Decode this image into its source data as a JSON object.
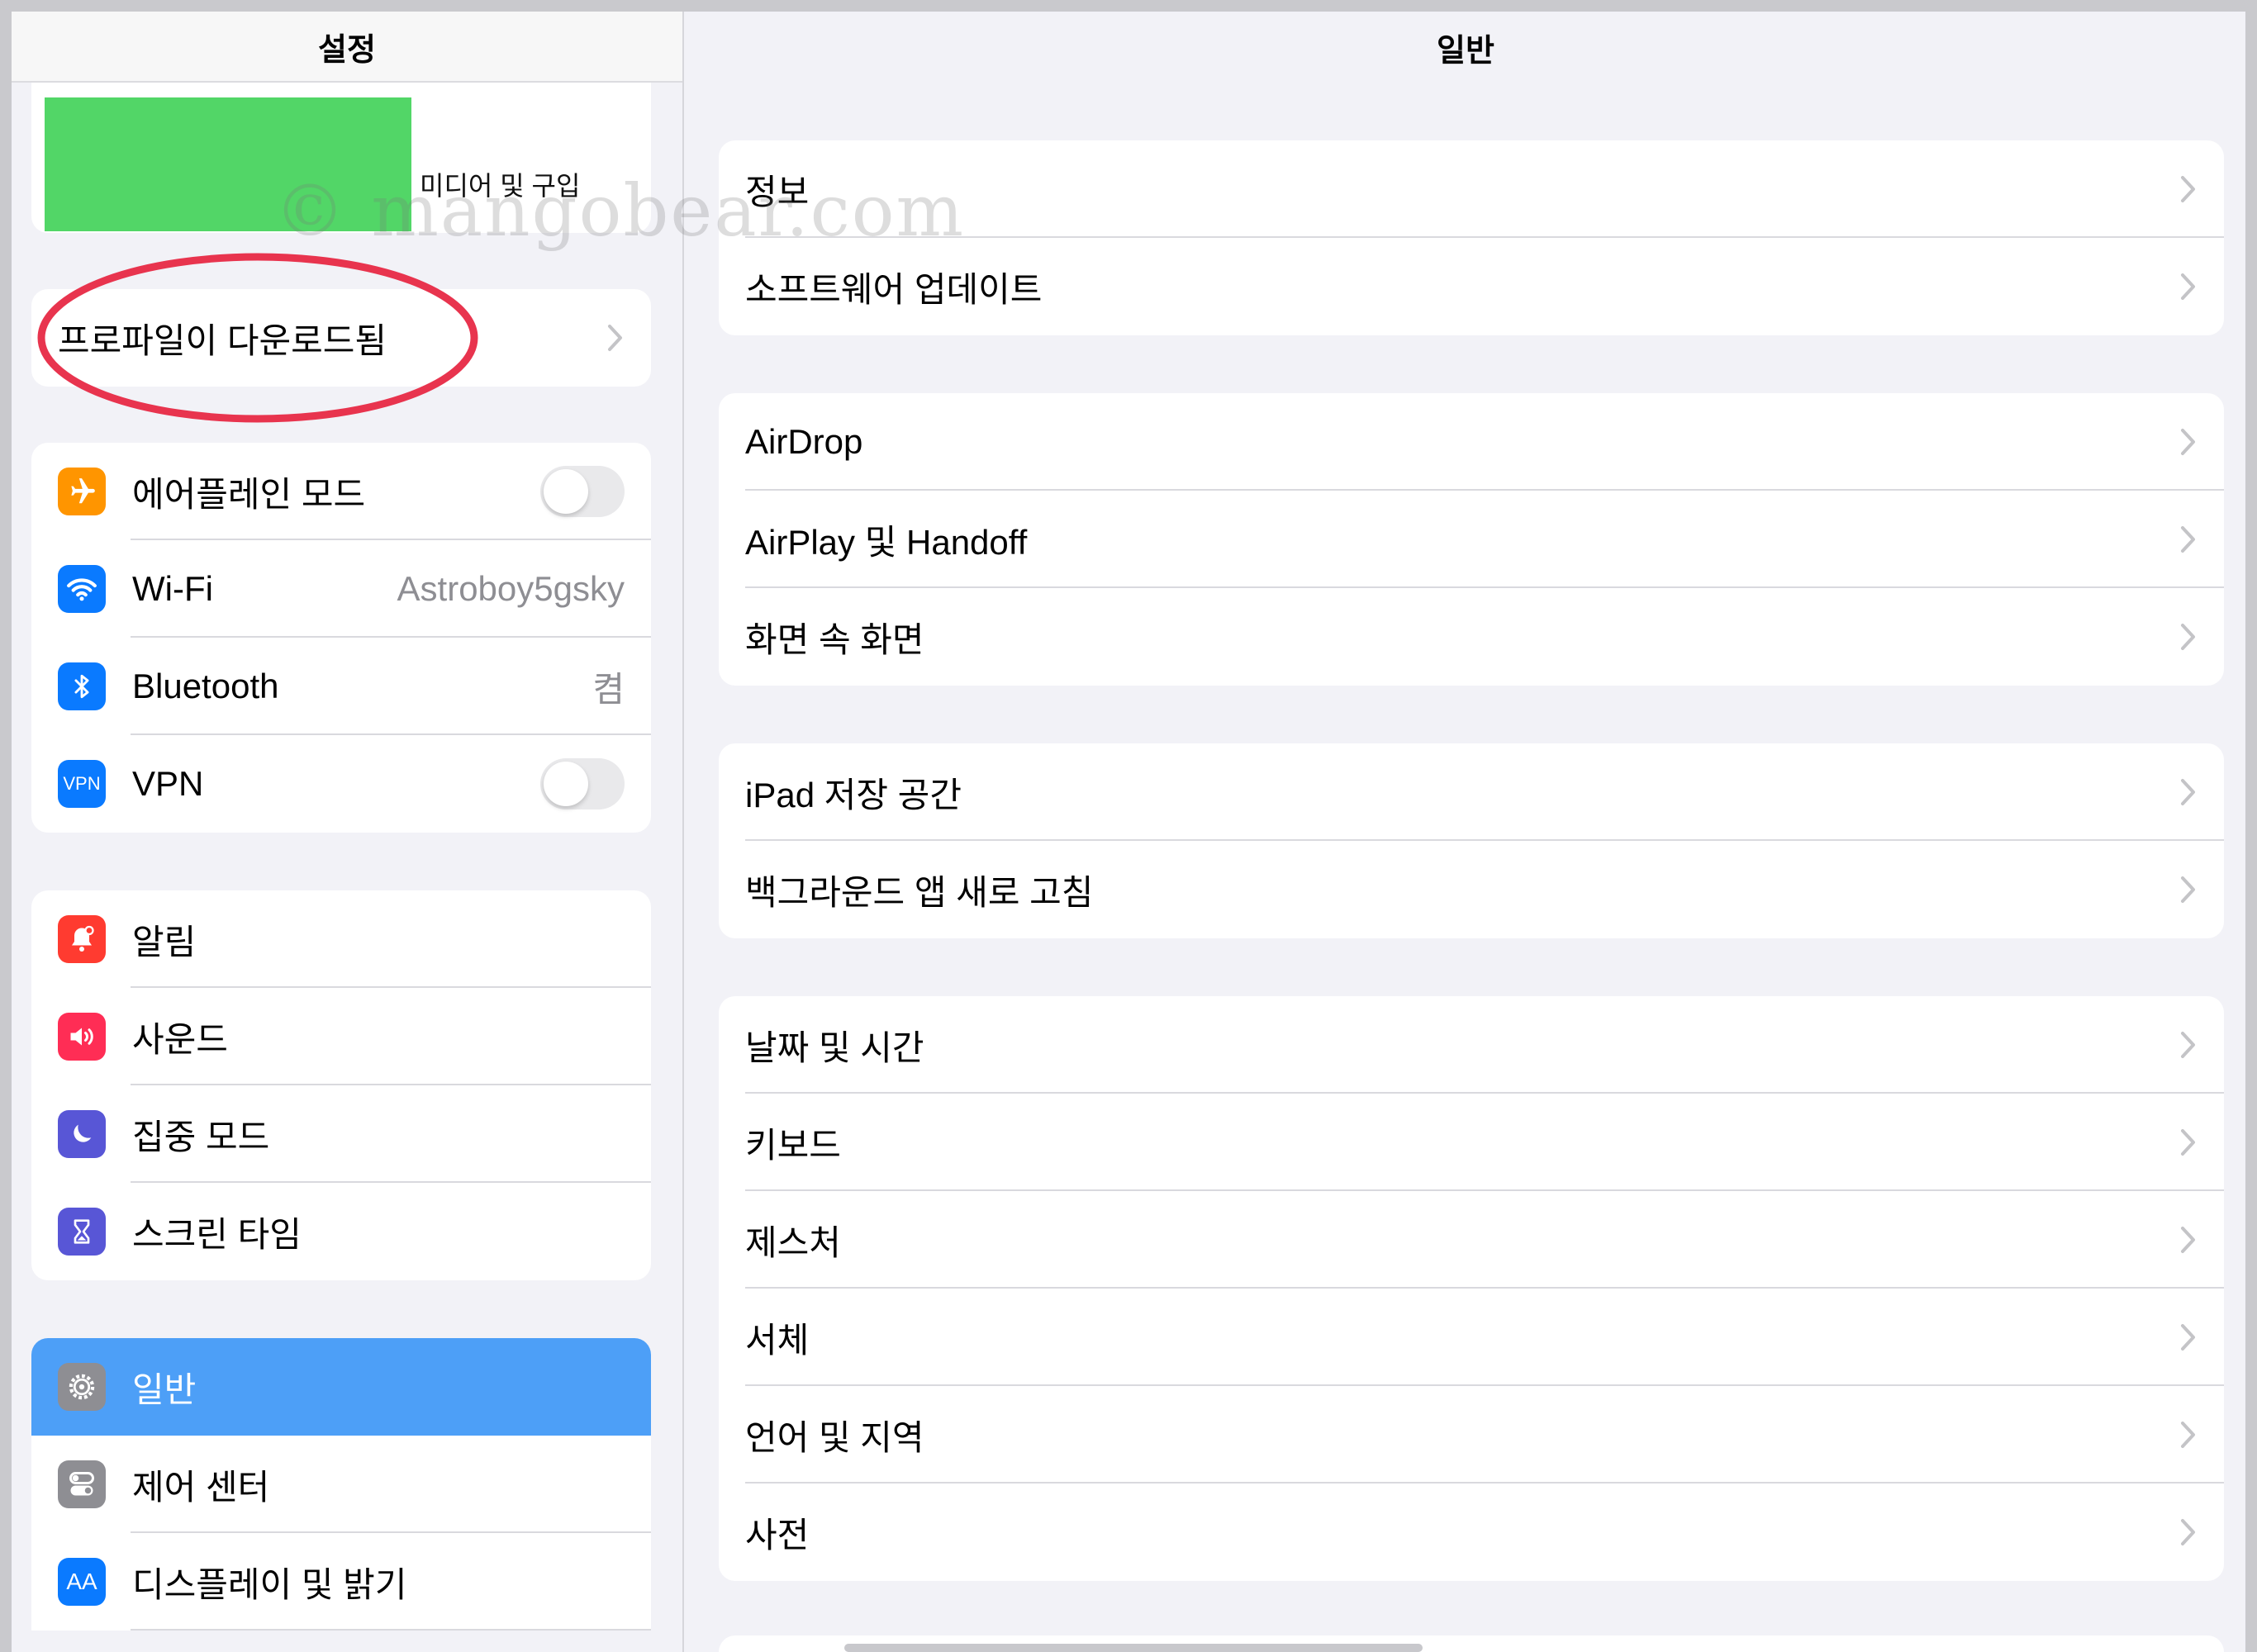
{
  "sidebar": {
    "title": "설정",
    "profile_subtitle": "미디어 및 구입",
    "profile_downloaded": "프로파일이 다운로드됨",
    "connectivity": [
      {
        "label": "에어플레인 모드",
        "icon": "airplane-icon",
        "color": "#ff9500",
        "control": "toggle"
      },
      {
        "label": "Wi-Fi",
        "icon": "wifi-icon",
        "color": "#0a7aff",
        "value": "Astroboy5gsky"
      },
      {
        "label": "Bluetooth",
        "icon": "bluetooth-icon",
        "color": "#0a7aff",
        "value": "켬"
      },
      {
        "label": "VPN",
        "icon": "vpn-icon",
        "icon_text": "VPN",
        "color": "#0a7aff",
        "control": "toggle"
      }
    ],
    "notifications": [
      {
        "label": "알림",
        "icon": "bell-icon",
        "color": "#ff3b30"
      },
      {
        "label": "사운드",
        "icon": "speaker-icon",
        "color": "#ff2d55"
      },
      {
        "label": "집중 모드",
        "icon": "moon-icon",
        "color": "#5856d6"
      },
      {
        "label": "스크린 타임",
        "icon": "hourglass-icon",
        "color": "#5856d6"
      }
    ],
    "general": [
      {
        "label": "일반",
        "icon": "gear-icon",
        "color": "#8e8e93",
        "selected": true
      },
      {
        "label": "제어 센터",
        "icon": "switches-icon",
        "color": "#8e8e93"
      },
      {
        "label": "디스플레이 및 밝기",
        "icon": "display-icon",
        "icon_text": "AA",
        "color": "#0a7aff"
      }
    ]
  },
  "detail": {
    "title": "일반",
    "groups": [
      [
        "정보",
        "소프트웨어 업데이트"
      ],
      [
        "AirDrop",
        "AirPlay 및 Handoff",
        "화면 속 화면"
      ],
      [
        "iPad 저장 공간",
        "백그라운드 앱 새로 고침"
      ],
      [
        "날짜 및 시간",
        "키보드",
        "제스처",
        "서체",
        "언어 및 지역",
        "사전"
      ]
    ]
  },
  "watermark": "© mangobear.com",
  "colors": {
    "selected_row": "#4d9ff7",
    "annotation": "#e8344e",
    "profile_block": "#52d667"
  }
}
